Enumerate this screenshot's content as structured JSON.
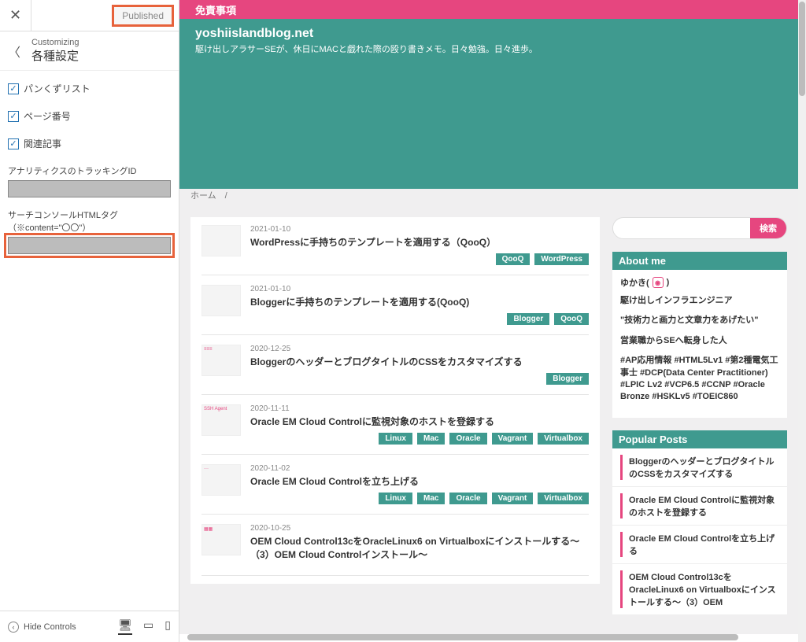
{
  "customizer": {
    "publish_label": "Published",
    "sub": "Customizing",
    "title": "各種設定",
    "checkboxes": [
      {
        "label": "パンくずリスト",
        "checked": true
      },
      {
        "label": "ページ番号",
        "checked": true
      },
      {
        "label": "関連記事",
        "checked": true
      }
    ],
    "field1_label": "アナリティクスのトラッキングID",
    "field2_label": "サーチコンソールHTMLタグ（※content=\"〇〇\"）",
    "hide_controls": "Hide Controls"
  },
  "topbar": {
    "link": "免責事項"
  },
  "hero": {
    "title": "yoshiislandblog.net",
    "desc": "駆け出しアラサーSEが、休日にMACと戯れた際の殴り書きメモ。日々勉強。日々進歩。"
  },
  "breadcrumb": "ホーム　/",
  "posts": [
    {
      "date": "2021-01-10",
      "title": "WordPressに手持ちのテンプレートを適用する（QooQ）",
      "tags": [
        "QooQ",
        "WordPress"
      ],
      "thumb": ""
    },
    {
      "date": "2021-01-10",
      "title": "Bloggerに手持ちのテンプレートを適用する(QooQ)",
      "tags": [
        "Blogger",
        "QooQ"
      ],
      "thumb": ""
    },
    {
      "date": "2020-12-25",
      "title": "BloggerのヘッダーとブログタイトルのCSSをカスタマイズする",
      "tags": [
        "Blogger"
      ],
      "thumb": "≡≡≡"
    },
    {
      "date": "2020-11-11",
      "title": "Oracle EM Cloud Controlに監視対象のホストを登録する",
      "tags": [
        "Linux",
        "Mac",
        "Oracle",
        "Vagrant",
        "Virtualbox"
      ],
      "thumb": "SSH Agent"
    },
    {
      "date": "2020-11-02",
      "title": "Oracle EM Cloud Controlを立ち上げる",
      "tags": [
        "Linux",
        "Mac",
        "Oracle",
        "Vagrant",
        "Virtualbox"
      ],
      "thumb": "···"
    },
    {
      "date": "2020-10-25",
      "title": "OEM Cloud Control13cをOracleLinux6 on Virtualboxにインストールする〜（3）OEM Cloud Controlインストール〜",
      "tags": [],
      "thumb": "▦▦"
    }
  ],
  "search": {
    "btn": "検索"
  },
  "about": {
    "heading": "About me",
    "name": "ゆかき(",
    "name_suffix": ")",
    "l1": "駆け出しインフラエンジニア",
    "l2": "\"技術力と画力と文章力をあげたい\"",
    "l3": "営業職からSEへ転身した人",
    "l4": "#AP応用情報 #HTML5Lv1 #第2種電気工事士 #DCP(Data Center Practitioner) #LPIC Lv2 #VCP6.5 #CCNP #Oracle Bronze #HSKLv5 #TOEIC860"
  },
  "popular": {
    "heading": "Popular Posts",
    "items": [
      "BloggerのヘッダーとブログタイトルのCSSをカスタマイズする",
      "Oracle EM Cloud Controlに監視対象のホストを登録する",
      "Oracle EM Cloud Controlを立ち上げる",
      "OEM Cloud Control13cをOracleLinux6 on Virtualboxにインストールする〜（3）OEM"
    ]
  }
}
